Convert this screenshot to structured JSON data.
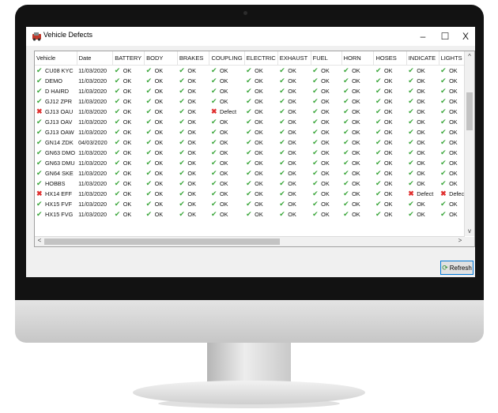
{
  "window": {
    "title": "Vehicle Defects",
    "minimize": "–",
    "maximize": "☐",
    "close": "X"
  },
  "columns": [
    "Vehicle",
    "Date",
    "BATTERY",
    "BODY",
    "BRAKES",
    "COUPLING",
    "ELECTRIC",
    "EXHAUST",
    "FUEL",
    "HORN",
    "HOSES",
    "INDICATE",
    "LIGHTS"
  ],
  "rows": [
    {
      "vehicle": "CU08 KYC",
      "vstatus": "ok",
      "date": "11/03/2020",
      "checks": [
        "OK",
        "OK",
        "OK",
        "OK",
        "OK",
        "OK",
        "OK",
        "OK",
        "OK",
        "OK",
        "OK"
      ]
    },
    {
      "vehicle": "DEMO",
      "vstatus": "ok",
      "date": "11/03/2020",
      "checks": [
        "OK",
        "OK",
        "OK",
        "OK",
        "OK",
        "OK",
        "OK",
        "OK",
        "OK",
        "OK",
        "OK"
      ]
    },
    {
      "vehicle": "D HAIRD",
      "vstatus": "ok",
      "date": "11/03/2020",
      "checks": [
        "OK",
        "OK",
        "OK",
        "OK",
        "OK",
        "OK",
        "OK",
        "OK",
        "OK",
        "OK",
        "OK"
      ]
    },
    {
      "vehicle": "GJ12 ZPR",
      "vstatus": "ok",
      "date": "11/03/2020",
      "checks": [
        "OK",
        "OK",
        "OK",
        "OK",
        "OK",
        "OK",
        "OK",
        "OK",
        "OK",
        "OK",
        "OK"
      ]
    },
    {
      "vehicle": "GJ13 OAU",
      "vstatus": "defect",
      "date": "11/03/2020",
      "checks": [
        "OK",
        "OK",
        "OK",
        "Defect",
        "OK",
        "OK",
        "OK",
        "OK",
        "OK",
        "OK",
        "OK"
      ]
    },
    {
      "vehicle": "GJ13 OAV",
      "vstatus": "ok",
      "date": "11/03/2020",
      "checks": [
        "OK",
        "OK",
        "OK",
        "OK",
        "OK",
        "OK",
        "OK",
        "OK",
        "OK",
        "OK",
        "OK"
      ]
    },
    {
      "vehicle": "GJ13 OAW",
      "vstatus": "ok",
      "date": "11/03/2020",
      "checks": [
        "OK",
        "OK",
        "OK",
        "OK",
        "OK",
        "OK",
        "OK",
        "OK",
        "OK",
        "OK",
        "OK"
      ]
    },
    {
      "vehicle": "GN14 ZDK",
      "vstatus": "ok",
      "date": "04/03/2020",
      "checks": [
        "OK",
        "OK",
        "OK",
        "OK",
        "OK",
        "OK",
        "OK",
        "OK",
        "OK",
        "OK",
        "OK"
      ]
    },
    {
      "vehicle": "GN63 DMO",
      "vstatus": "ok",
      "date": "11/03/2020",
      "checks": [
        "OK",
        "OK",
        "OK",
        "OK",
        "OK",
        "OK",
        "OK",
        "OK",
        "OK",
        "OK",
        "OK"
      ]
    },
    {
      "vehicle": "GN63 DMU",
      "vstatus": "ok",
      "date": "11/03/2020",
      "checks": [
        "OK",
        "OK",
        "OK",
        "OK",
        "OK",
        "OK",
        "OK",
        "OK",
        "OK",
        "OK",
        "OK"
      ]
    },
    {
      "vehicle": "GN64 SKE",
      "vstatus": "ok",
      "date": "11/03/2020",
      "checks": [
        "OK",
        "OK",
        "OK",
        "OK",
        "OK",
        "OK",
        "OK",
        "OK",
        "OK",
        "OK",
        "OK"
      ]
    },
    {
      "vehicle": "HOBBS",
      "vstatus": "ok",
      "date": "11/03/2020",
      "checks": [
        "OK",
        "OK",
        "OK",
        "OK",
        "OK",
        "OK",
        "OK",
        "OK",
        "OK",
        "OK",
        "OK"
      ]
    },
    {
      "vehicle": "HX14 EFF",
      "vstatus": "defect",
      "date": "11/03/2020",
      "checks": [
        "OK",
        "OK",
        "OK",
        "OK",
        "OK",
        "OK",
        "OK",
        "OK",
        "OK",
        "Defect",
        "Defect"
      ]
    },
    {
      "vehicle": "HX15 FVF",
      "vstatus": "ok",
      "date": "11/03/2020",
      "checks": [
        "OK",
        "OK",
        "OK",
        "OK",
        "OK",
        "OK",
        "OK",
        "OK",
        "OK",
        "OK",
        "OK"
      ]
    },
    {
      "vehicle": "HX15 FVG",
      "vstatus": "ok",
      "date": "11/03/2020",
      "checks": [
        "OK",
        "OK",
        "OK",
        "OK",
        "OK",
        "OK",
        "OK",
        "OK",
        "OK",
        "OK",
        "OK"
      ]
    }
  ],
  "icons": {
    "ok": "green-checkmark-icon",
    "defect": "red-cross-icon"
  },
  "colors": {
    "ok": "#3aa63a",
    "defect": "#e0302f",
    "accent": "#0078d7"
  },
  "refresh_button": {
    "label": "Refresh"
  },
  "scroll_arrows": {
    "up": "^",
    "down": "v",
    "left": "<",
    "right": ">"
  }
}
